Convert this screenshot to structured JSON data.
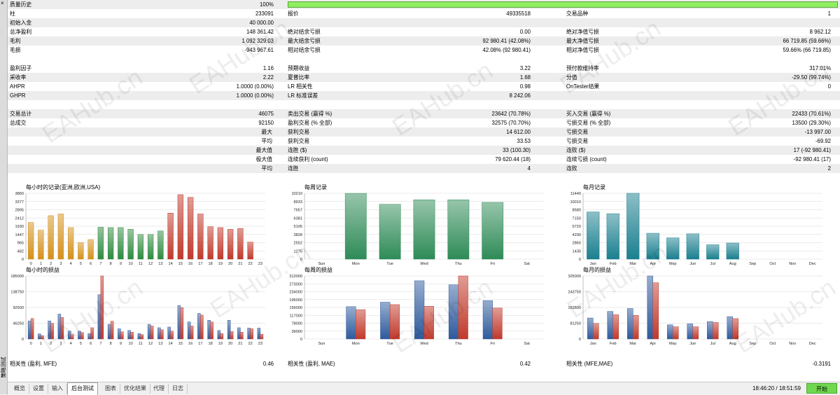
{
  "side": {
    "close": "×",
    "title": "策略测试"
  },
  "quality_bar": {
    "fraction": 1.0
  },
  "rows": [
    {
      "y": 0,
      "g": true,
      "cells": [
        "质量历史",
        "100%",
        "",
        "",
        "",
        ""
      ]
    },
    {
      "y": 13,
      "g": false,
      "cells": [
        "柱",
        "233091",
        "报价",
        "49335518",
        "交易品种",
        "1"
      ]
    },
    {
      "y": 26,
      "g": true,
      "cells": [
        "初始入金",
        "40 000.00",
        "",
        "",
        "",
        ""
      ]
    },
    {
      "y": 39,
      "g": false,
      "cells": [
        "总净盈利",
        "148 361.42",
        "绝对结余亏损",
        "0.00",
        "绝对净值亏损",
        "8 962.12"
      ]
    },
    {
      "y": 52,
      "g": true,
      "cells": [
        "毛利",
        "1 092 329.03",
        "最大结余亏损",
        "92 980.41 (42.08%)",
        "最大净值亏损",
        "66 719.85 (59.66%)"
      ]
    },
    {
      "y": 65,
      "g": false,
      "cells": [
        "毛损",
        "-943 967.61",
        "相对结余亏损",
        "42.08% (92 980.41)",
        "相对净值亏损",
        "59.66% (66 719.85)"
      ]
    },
    {
      "y": 91,
      "g": false,
      "cells": [
        "盈利因子",
        "1.16",
        "预期收益",
        "3.22",
        "预付款维持率",
        "317.01%"
      ]
    },
    {
      "y": 104,
      "g": true,
      "cells": [
        "采收率",
        "2.22",
        "夏普比率",
        "1.68",
        "分值",
        "-29.50 (99.74%)"
      ]
    },
    {
      "y": 117,
      "g": false,
      "cells": [
        "AHPR",
        "1.0000 (0.00%)",
        "LR 相关性",
        "0.98",
        "OnTester结果",
        "0"
      ]
    },
    {
      "y": 130,
      "g": true,
      "cells": [
        "GHPR",
        "1.0000 (0.00%)",
        "LR 标准误差",
        "8 242.06",
        "",
        ""
      ]
    },
    {
      "y": 156,
      "g": true,
      "cells": [
        "交易总计",
        "46075",
        "卖出交易 (赢得 %)",
        "23642 (70.78%)",
        "买入交易 (赢得 %)",
        "22433 (70.61%)"
      ]
    },
    {
      "y": 169,
      "g": false,
      "cells": [
        "总成交",
        "92150",
        "盈利交易 (% 全部)",
        "32575 (70.70%)",
        "亏损交易 (% 全部)",
        "13500 (29.30%)"
      ]
    },
    {
      "y": 182,
      "g": true,
      "cells": [
        "最大",
        "",
        "获利交易",
        "14 612.00",
        "亏损交易",
        "-13 997.00"
      ]
    },
    {
      "y": 195,
      "g": false,
      "cells": [
        "平均",
        "",
        "获利交易",
        "33.53",
        "亏损交易",
        "-69.92"
      ]
    },
    {
      "y": 208,
      "g": true,
      "cells": [
        "最大值",
        "",
        "连胜 ($)",
        "33 (100.30)",
        "连败 ($)",
        "17 (-92 980.41)"
      ]
    },
    {
      "y": 221,
      "g": false,
      "cells": [
        "极大值",
        "",
        "连续获利 (count)",
        "79 620.44 (18)",
        "连续亏损 (count)",
        "-92 980.41 (17)"
      ]
    },
    {
      "y": 234,
      "g": true,
      "cells": [
        "平均",
        "",
        "连胜",
        "4",
        "连败",
        "2"
      ]
    }
  ],
  "correlation": [
    "相关性 (盈利, MFE)",
    "0.46",
    "相关性 (盈利, MAE)",
    "0.42",
    "相关性 (MFE,MAE)",
    "-0.3191"
  ],
  "tabs": [
    {
      "label": "概览",
      "active": false
    },
    {
      "label": "设置",
      "active": false
    },
    {
      "label": "输入",
      "active": false
    },
    {
      "label": "后台测试",
      "active": true
    },
    {
      "label": "图表",
      "active": false
    },
    {
      "label": "优化结果",
      "active": false
    },
    {
      "label": "代理",
      "active": false
    },
    {
      "label": "日志",
      "active": false
    }
  ],
  "status": {
    "time": "18:46:20 / 18:51:59",
    "start_button": "开始"
  },
  "watermark": "EAHub.cn",
  "colors": {
    "hour_gold": "#d4901a",
    "hour_green": "#2e8b3e",
    "hour_red": "#c0392b",
    "week_green": "#2e8b57",
    "month_teal": "#1a7f8f",
    "pnl_blue": "#2e5a9c",
    "pnl_red": "#c0392b"
  },
  "chart_data": [
    {
      "type": "bar",
      "title": "每小时的记录(亚洲,欧洲,USA)",
      "categories": [
        "0",
        "1",
        "2",
        "3",
        "4",
        "5",
        "6",
        "7",
        "8",
        "9",
        "10",
        "11",
        "12",
        "13",
        "14",
        "15",
        "16",
        "17",
        "18",
        "19",
        "20",
        "21",
        "22",
        "23"
      ],
      "y_ticks": [
        "3860",
        "3377",
        "2895",
        "2412",
        "1930",
        "1447",
        "965",
        "482",
        "0"
      ],
      "ylim": [
        0,
        3860
      ],
      "series": [
        {
          "values": [
            2150,
            1700,
            2550,
            2650,
            1850,
            970,
            1150,
            1870,
            1850,
            1850,
            1750,
            1450,
            1450,
            1650,
            2700,
            3780,
            3620,
            2650,
            1900,
            1850,
            1750,
            1800,
            1000,
            0
          ]
        }
      ],
      "bar_colors": [
        "gold",
        "gold",
        "gold",
        "gold",
        "gold",
        "gold",
        "gold",
        "green",
        "green",
        "green",
        "green",
        "green",
        "green",
        "green",
        "red",
        "red",
        "red",
        "red",
        "red",
        "red",
        "red",
        "red",
        "red",
        "red"
      ]
    },
    {
      "type": "bar",
      "title": "每周记录",
      "categories": [
        "Sun",
        "Mon",
        "Tue",
        "Wed",
        "Thu",
        "Fri",
        "Sat"
      ],
      "y_ticks": [
        "10210",
        "8933",
        "7657",
        "6381",
        "5105",
        "3828",
        "2552",
        "1276",
        "0"
      ],
      "ylim": [
        0,
        10210
      ],
      "series": [
        {
          "values": [
            0,
            10200,
            8500,
            9200,
            9200,
            8800,
            0
          ]
        }
      ]
    },
    {
      "type": "bar",
      "title": "每月记录",
      "categories": [
        "Jan",
        "Feb",
        "Mar",
        "Apr",
        "May",
        "Jun",
        "Jul",
        "Aug",
        "Sep",
        "Oct",
        "Nov",
        "Dec"
      ],
      "y_ticks": [
        "11440",
        "10010",
        "8580",
        "7150",
        "5720",
        "4290",
        "2860",
        "1430",
        "0"
      ],
      "ylim": [
        0,
        11440
      ],
      "series": [
        {
          "values": [
            8200,
            7900,
            11440,
            4500,
            3700,
            4400,
            2500,
            2800,
            0,
            0,
            0,
            0
          ]
        }
      ]
    },
    {
      "type": "bar",
      "title": "每小时的损益",
      "categories": [
        "0",
        "1",
        "2",
        "3",
        "4",
        "5",
        "6",
        "7",
        "8",
        "9",
        "10",
        "11",
        "12",
        "13",
        "14",
        "15",
        "16",
        "17",
        "18",
        "19",
        "20",
        "21",
        "22",
        "23"
      ],
      "y_ticks": [
        "185000",
        "138750",
        "92500",
        "46250",
        "0"
      ],
      "ylim": [
        0,
        185000
      ],
      "series": [
        {
          "values": [
            53000,
            15000,
            53000,
            73000,
            23000,
            23000,
            16000,
            130000,
            43000,
            30000,
            25000,
            16000,
            43000,
            33000,
            35000,
            98000,
            50000,
            75000,
            55000,
            25000,
            55000,
            33000,
            32000,
            32000
          ]
        },
        {
          "values": [
            60000,
            10000,
            46000,
            63000,
            13000,
            19000,
            33000,
            185000,
            52000,
            21000,
            20000,
            13000,
            38000,
            27000,
            23000,
            92000,
            38000,
            70000,
            50000,
            16000,
            22000,
            20000,
            30000,
            14000
          ]
        }
      ]
    },
    {
      "type": "bar",
      "title": "每周的损益",
      "categories": [
        "Sun",
        "Mon",
        "Tue",
        "Wed",
        "Thu",
        "Fri",
        "Sat"
      ],
      "y_ticks": [
        "312000",
        "273000",
        "234000",
        "195000",
        "156000",
        "117000",
        "78000",
        "39000",
        "0"
      ],
      "ylim": [
        0,
        312000
      ],
      "series": [
        {
          "values": [
            0,
            160000,
            182000,
            288000,
            268000,
            190000,
            0
          ]
        },
        {
          "values": [
            0,
            145000,
            170000,
            162000,
            312000,
            153000,
            0
          ]
        }
      ]
    },
    {
      "type": "bar",
      "title": "每月的损益",
      "categories": [
        "Jan",
        "Feb",
        "Mar",
        "Apr",
        "May",
        "Jun",
        "Jul",
        "Aug",
        "Sep",
        "Oct",
        "Nov",
        "Dec"
      ],
      "y_ticks": [
        "325000",
        "243750",
        "162500",
        "81250",
        "0"
      ],
      "ylim": [
        0,
        325000
      ],
      "series": [
        {
          "values": [
            108000,
            142000,
            157000,
            325000,
            73000,
            78000,
            90000,
            115000,
            0,
            0,
            0,
            0
          ]
        },
        {
          "values": [
            80000,
            125000,
            122000,
            290000,
            63000,
            63000,
            85000,
            105000,
            0,
            0,
            0,
            0
          ]
        }
      ]
    }
  ]
}
